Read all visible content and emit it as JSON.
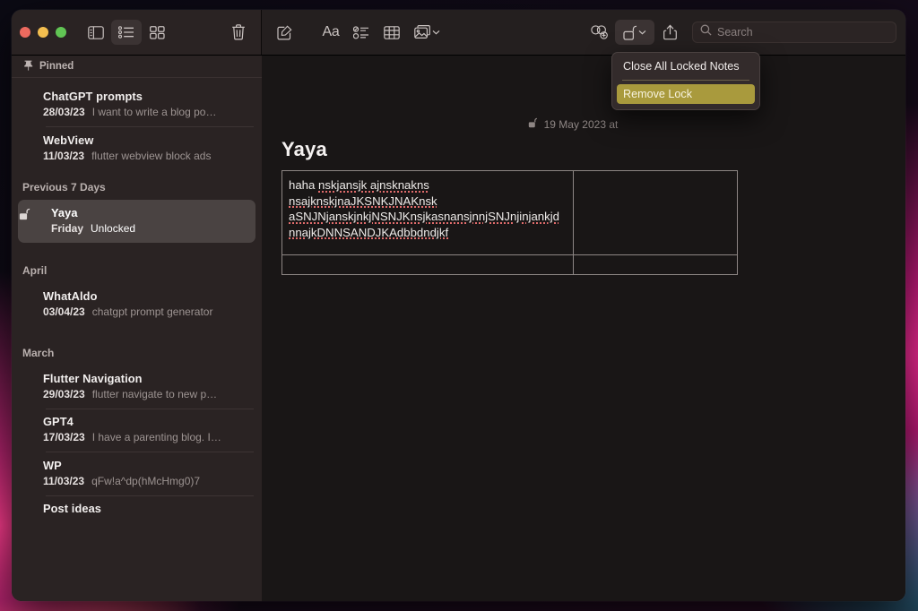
{
  "window": {
    "traffic_lights": [
      "close",
      "minimize",
      "zoom"
    ],
    "colors": {
      "close": "#ec6a5f",
      "minimize": "#f3be4f",
      "zoom": "#61c554",
      "menu_highlight": "#a99a3d",
      "sidebar_bg": "#2a2323",
      "note_bg": "#191616",
      "selected_row": "#4a4342"
    }
  },
  "toolbar": {
    "sidebar_toggle": "sidebar-toggle-icon",
    "list_view": "list-view-icon",
    "gallery_view": "gallery-view-icon",
    "delete": "trash-icon",
    "compose": "compose-note-icon",
    "format": "Aa",
    "checklist": "checklist-icon",
    "table": "table-icon",
    "media": "media-icon",
    "media_chevron": "chevron-down-icon",
    "collaborate": "add-people-icon",
    "lock": "unlocked-padlock-icon",
    "lock_chevron": "chevron-down-icon",
    "share": "share-icon"
  },
  "search": {
    "placeholder": "Search",
    "value": "",
    "icon": "search-icon"
  },
  "lock_menu": {
    "items": [
      {
        "label": "Close All Locked Notes",
        "highlighted": false
      },
      {
        "label": "Remove Lock",
        "highlighted": true
      }
    ]
  },
  "sidebar": {
    "pinned_label": "Pinned",
    "pinned_icon": "pin-icon",
    "groups": [
      {
        "header": null,
        "notes": [
          {
            "title": "ChatGPT prompts",
            "date": "28/03/23",
            "preview": "I want to write a blog po…",
            "selected": false,
            "locked": false
          },
          {
            "title": "WebView",
            "date": "11/03/23",
            "preview": "flutter webview block ads",
            "selected": false,
            "locked": false
          }
        ]
      },
      {
        "header": "Previous 7 Days",
        "notes": [
          {
            "title": "Yaya",
            "date": "Friday",
            "preview": "Unlocked",
            "selected": true,
            "locked": true,
            "lock_icon": "unlocked-padlock-icon"
          }
        ]
      },
      {
        "header": "April",
        "notes": [
          {
            "title": "WhatAldo",
            "date": "03/04/23",
            "preview": "chatgpt prompt generator",
            "selected": false,
            "locked": false
          }
        ]
      },
      {
        "header": "March",
        "notes": [
          {
            "title": "Flutter Navigation",
            "date": "29/03/23",
            "preview": "flutter navigate to new p…",
            "selected": false,
            "locked": false
          },
          {
            "title": "GPT4",
            "date": "17/03/23",
            "preview": "I have a parenting blog. I…",
            "selected": false,
            "locked": false
          },
          {
            "title": "WP",
            "date": "11/03/23",
            "preview": "qFw!a^dp(hMcHmg0)7",
            "selected": false,
            "locked": false
          },
          {
            "title": "Post ideas",
            "date": "",
            "preview": "",
            "selected": false,
            "locked": false
          }
        ]
      }
    ]
  },
  "note": {
    "date": "19 May 2023 at",
    "date_icon": "unlocked-padlock-icon",
    "title": "Yaya",
    "table": {
      "rows": [
        {
          "cells": [
            {
              "lines": [
                {
                  "plain": "haha ",
                  "spell": "nskjansjk ajnsknakns"
                },
                {
                  "plain": "",
                  "spell": "nsajknskjnaJKSNKJNAKnsk"
                },
                {
                  "plain": "",
                  "spell": "aSNJNjanskjnkjNSNJKnsjkasnansjnnjSNJnjinjankjd"
                },
                {
                  "plain": "",
                  "spell": "nnajkDNNSANDJKAdbbdndjkf"
                }
              ]
            },
            {
              "lines": []
            }
          ]
        },
        {
          "cells": [
            {
              "lines": []
            },
            {
              "lines": []
            }
          ]
        }
      ]
    }
  }
}
